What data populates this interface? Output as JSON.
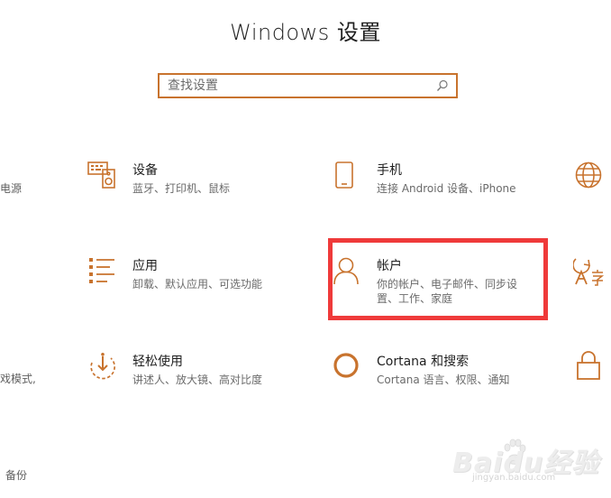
{
  "window": {
    "title": "Windows 设置"
  },
  "search": {
    "placeholder": "查找设置"
  },
  "colors": {
    "accent": "#c8732e",
    "highlight": "#ef3a3a"
  },
  "tiles": [
    {
      "icon": "keyboard-speaker-icon",
      "name": "设备",
      "desc": "蓝牙、打印机、鼠标"
    },
    {
      "icon": "phone-icon",
      "name": "手机",
      "desc": "连接 Android 设备、iPhone"
    },
    {
      "icon": "apps-list-icon",
      "name": "应用",
      "desc": "卸载、默认应用、可选功能"
    },
    {
      "icon": "person-icon",
      "name": "帐户",
      "desc": "你的帐户、电子邮件、同步设置、工作、家庭"
    },
    {
      "icon": "ease-of-access-icon",
      "name": "轻松使用",
      "desc": "讲述人、放大镜、高对比度"
    },
    {
      "icon": "cortana-circle-icon",
      "name": "Cortana 和搜索",
      "desc": "Cortana 语言、权限、通知"
    }
  ],
  "left_fragments": [
    "电源",
    "戏模式,",
    "备份"
  ],
  "watermark": {
    "text": "Baidu经验",
    "url": "jingyan.baidu.com"
  }
}
